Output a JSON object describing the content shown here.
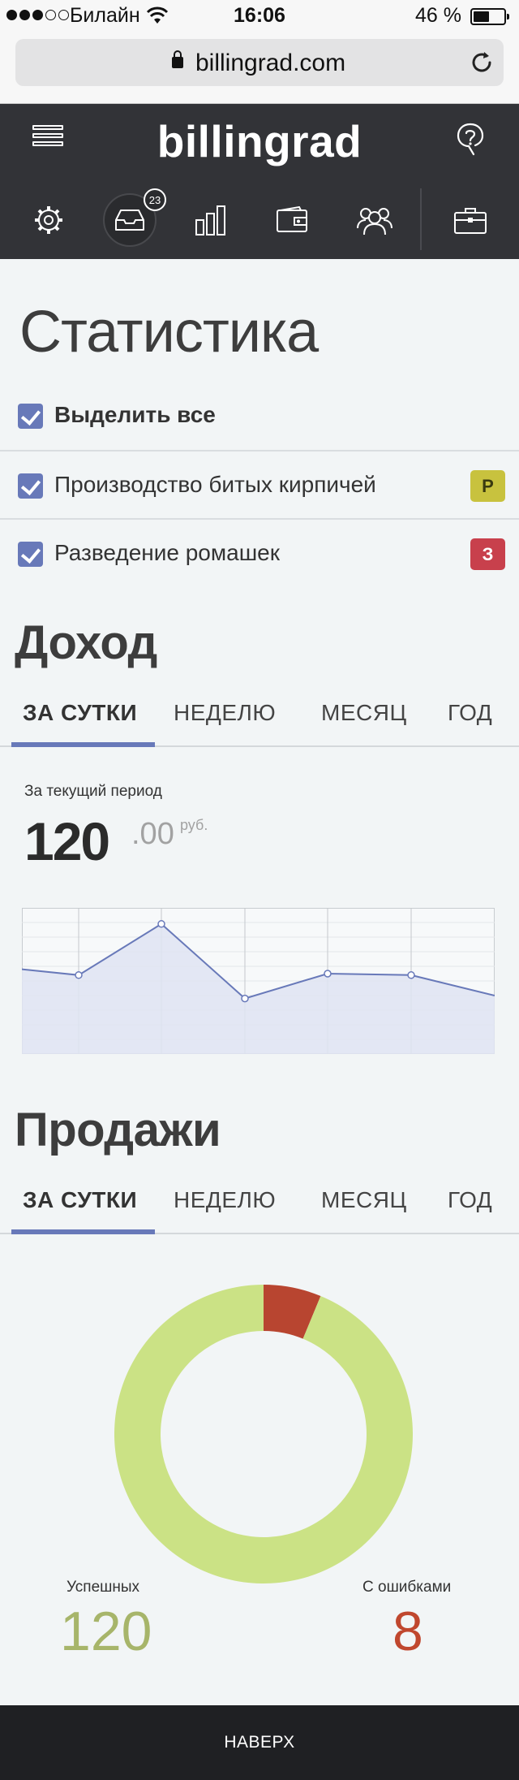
{
  "status_bar": {
    "carrier": "Билайн",
    "time": "16:06",
    "battery": "46 %",
    "battery_level_pct": 46
  },
  "browser": {
    "url": "billingrad.com"
  },
  "header": {
    "logo": "billingrad",
    "inbox_badge": "23",
    "nav_icons": [
      "settings-icon",
      "inbox-icon",
      "stats-icon",
      "wallet-icon",
      "users-icon",
      "briefcase-icon"
    ]
  },
  "page": {
    "title": "Статистика"
  },
  "filters": {
    "select_all": "Выделить все",
    "items": [
      {
        "label": "Производство битых кирпичей",
        "tag": "Р",
        "tag_bg": "#c8c23e",
        "tag_fg": "#3a3a10"
      },
      {
        "label": "Разведение ромашек",
        "tag": "З",
        "tag_bg": "#c8404c",
        "tag_fg": "#ffffff"
      }
    ]
  },
  "income": {
    "title": "Доход",
    "tabs": [
      "ЗА СУТКИ",
      "НЕДЕЛЮ",
      "МЕСЯЦ",
      "ГОД"
    ],
    "period_label": "За текущий период",
    "amount_int": "120",
    "amount_dec": ".00",
    "currency": "руб."
  },
  "chart_data": [
    {
      "type": "area",
      "x": [
        0,
        1,
        2,
        3,
        4,
        5,
        6
      ],
      "values": [
        58,
        54,
        89,
        38,
        55,
        54,
        40
      ],
      "ylim": [
        0,
        100
      ],
      "grid": true,
      "color": "#6879b9",
      "fill": "#dfe4f2"
    },
    {
      "type": "pie",
      "donut": true,
      "categories": [
        "Успешных",
        "С ошибками"
      ],
      "values": [
        120,
        8
      ],
      "colors": [
        "#cbe285",
        "#b84530"
      ]
    }
  ],
  "sales": {
    "title": "Продажи",
    "tabs": [
      "ЗА СУТКИ",
      "НЕДЕЛЮ",
      "МЕСЯЦ",
      "ГОД"
    ],
    "success_label": "Успешных",
    "success_value": "120",
    "success_color": "#a7b56a",
    "error_label": "С ошибками",
    "error_value": "8",
    "error_color": "#c0472e"
  },
  "footer": {
    "to_top": "НАВЕРХ"
  }
}
